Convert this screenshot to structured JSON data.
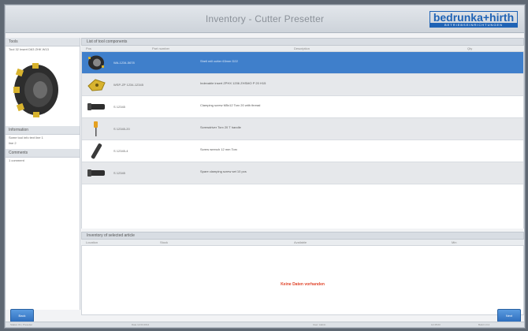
{
  "window": {
    "title": "Inventory - Cutter Presetter"
  },
  "brand": {
    "logo_text": "bedrunka+hirth",
    "logo_sub": "BETRIEBSEINRICHTUNGEN"
  },
  "sidebar": {
    "header": "Tools",
    "tool_line": "Tool 32 Insert D63 ZHK W13",
    "section1": {
      "header": "Information",
      "lines": [
        "Some tool info text line 1",
        "line 2"
      ]
    },
    "section2": {
      "header": "Comments",
      "lines": [
        "1 comment"
      ]
    }
  },
  "parts_panel": {
    "header": "List of tool components",
    "columns": [
      "Pos",
      "Part number",
      "Description",
      "Qty"
    ],
    "rows": [
      {
        "num": "WA-1234-5678",
        "desc": "Shell mill cutter 63mm D22",
        "icon": "cutter-icon"
      },
      {
        "num": "WSP-ZP 1234-12345",
        "desc": "Indexable insert ZPHX 1206 ZHSMO P 20 H15",
        "icon": "insert-icon"
      },
      {
        "num": "S 12345",
        "desc": "Clamping screw M5x12 Torx 20 with thread",
        "icon": "screw-icon"
      },
      {
        "num": "S 12345-20",
        "desc": "Screwdriver Torx 20 T handle",
        "icon": "screwdriver-icon"
      },
      {
        "num": "S 12345-4",
        "desc": "Screw wrench 12 mm Torx",
        "icon": "wrench-icon"
      },
      {
        "num": "S 12345",
        "desc": "Spare clamping screw set 10 pcs",
        "icon": "screw-icon"
      }
    ]
  },
  "stock_panel": {
    "header": "Inventory of selected article",
    "columns": [
      "Location",
      "Stock",
      "Available",
      "Min"
    ],
    "empty_message": "Keine Daten vorhanden"
  },
  "buttons": {
    "back": "Back",
    "next": "Next"
  },
  "status": [
    "Station 01 | Presetter",
    "Date 12.03.2014",
    "User: Admin",
    "12:45:03",
    "Build 1.0.4"
  ],
  "colors": {
    "accent": "#3f7fcb",
    "brand": "#1f63b5",
    "warning_text": "#e0452b"
  }
}
